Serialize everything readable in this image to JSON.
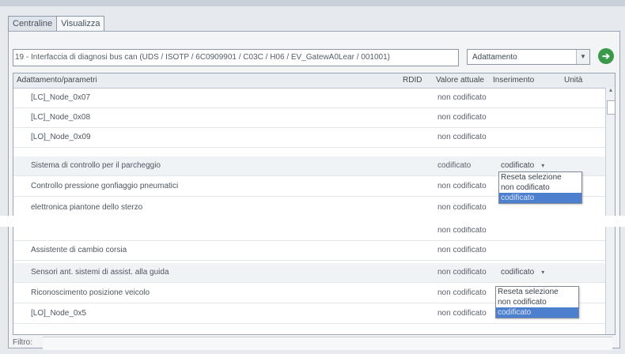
{
  "tabs": [
    "Centraline",
    "Visualizza"
  ],
  "path": "19 - Interfaccia di diagnosi bus can (UDS / ISOTP / 6C0909901 / C03C / H06 / EV_GatewA0Lear / 001001)",
  "mode_select": {
    "value": "Adattamento"
  },
  "columns": [
    "Adattamento/parametri",
    "RDID",
    "Valore attuale",
    "Inserimento",
    "Unità"
  ],
  "rows": [
    {
      "name": "[LC]_Node_0x07",
      "value": "non codificato",
      "input": ""
    },
    {
      "name": "[LC]_Node_0x08",
      "value": "non codificato",
      "input": ""
    },
    {
      "name": "[LO]_Node_0x09",
      "value": "non codificato",
      "input": ""
    },
    {
      "name": "Sistema di controllo per il parcheggio",
      "value": "codificato",
      "input": "codificato"
    },
    {
      "name": "Controllo pressione gonfiaggio pneumatici",
      "value": "non codificato",
      "input": ""
    },
    {
      "name": "elettronica piantone dello sterzo",
      "value": "non codificato",
      "input": ""
    },
    {
      "name": "",
      "value": "non codificato",
      "input": ""
    },
    {
      "name": "Assistente di cambio corsia",
      "value": "non codificato",
      "input": ""
    },
    {
      "name": "Sensori ant. sistemi di assist. alla guida",
      "value": "non codificato",
      "input": "codificato"
    },
    {
      "name": "Riconoscimento posizione veicolo",
      "value": "non codificato",
      "input": ""
    },
    {
      "name": "[LO]_Node_0x5",
      "value": "non codificato",
      "input": ""
    }
  ],
  "dropdown_options": [
    "Reseta selezione",
    "non codificato",
    "codificato"
  ],
  "filter_label": "Filtro:",
  "icons": {
    "go": "green-arrow-icon",
    "combo_arrow": "chevron-down-icon"
  }
}
